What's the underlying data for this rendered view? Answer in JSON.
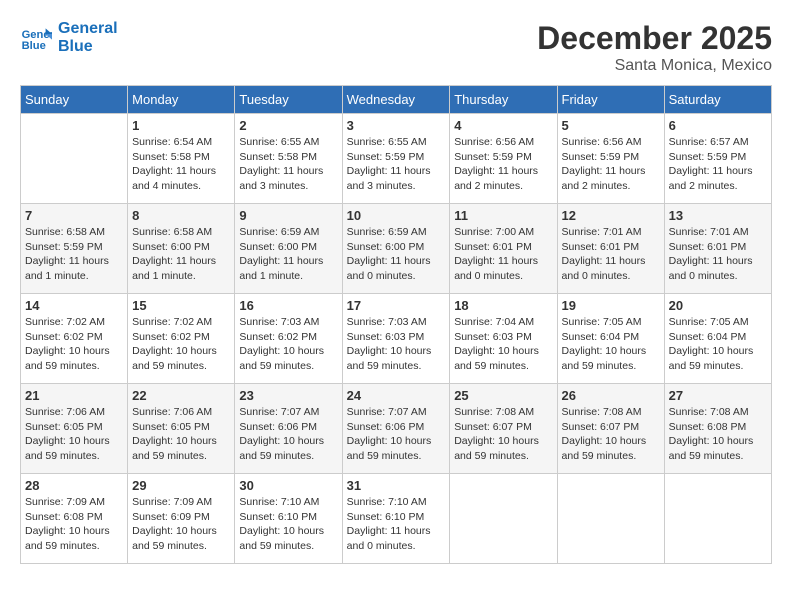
{
  "header": {
    "logo_line1": "General",
    "logo_line2": "Blue",
    "month": "December 2025",
    "location": "Santa Monica, Mexico"
  },
  "weekdays": [
    "Sunday",
    "Monday",
    "Tuesday",
    "Wednesday",
    "Thursday",
    "Friday",
    "Saturday"
  ],
  "weeks": [
    [
      {
        "day": "",
        "info": ""
      },
      {
        "day": "1",
        "info": "Sunrise: 6:54 AM\nSunset: 5:58 PM\nDaylight: 11 hours\nand 4 minutes."
      },
      {
        "day": "2",
        "info": "Sunrise: 6:55 AM\nSunset: 5:58 PM\nDaylight: 11 hours\nand 3 minutes."
      },
      {
        "day": "3",
        "info": "Sunrise: 6:55 AM\nSunset: 5:59 PM\nDaylight: 11 hours\nand 3 minutes."
      },
      {
        "day": "4",
        "info": "Sunrise: 6:56 AM\nSunset: 5:59 PM\nDaylight: 11 hours\nand 2 minutes."
      },
      {
        "day": "5",
        "info": "Sunrise: 6:56 AM\nSunset: 5:59 PM\nDaylight: 11 hours\nand 2 minutes."
      },
      {
        "day": "6",
        "info": "Sunrise: 6:57 AM\nSunset: 5:59 PM\nDaylight: 11 hours\nand 2 minutes."
      }
    ],
    [
      {
        "day": "7",
        "info": "Sunrise: 6:58 AM\nSunset: 5:59 PM\nDaylight: 11 hours\nand 1 minute."
      },
      {
        "day": "8",
        "info": "Sunrise: 6:58 AM\nSunset: 6:00 PM\nDaylight: 11 hours\nand 1 minute."
      },
      {
        "day": "9",
        "info": "Sunrise: 6:59 AM\nSunset: 6:00 PM\nDaylight: 11 hours\nand 1 minute."
      },
      {
        "day": "10",
        "info": "Sunrise: 6:59 AM\nSunset: 6:00 PM\nDaylight: 11 hours\nand 0 minutes."
      },
      {
        "day": "11",
        "info": "Sunrise: 7:00 AM\nSunset: 6:01 PM\nDaylight: 11 hours\nand 0 minutes."
      },
      {
        "day": "12",
        "info": "Sunrise: 7:01 AM\nSunset: 6:01 PM\nDaylight: 11 hours\nand 0 minutes."
      },
      {
        "day": "13",
        "info": "Sunrise: 7:01 AM\nSunset: 6:01 PM\nDaylight: 11 hours\nand 0 minutes."
      }
    ],
    [
      {
        "day": "14",
        "info": "Sunrise: 7:02 AM\nSunset: 6:02 PM\nDaylight: 10 hours\nand 59 minutes."
      },
      {
        "day": "15",
        "info": "Sunrise: 7:02 AM\nSunset: 6:02 PM\nDaylight: 10 hours\nand 59 minutes."
      },
      {
        "day": "16",
        "info": "Sunrise: 7:03 AM\nSunset: 6:02 PM\nDaylight: 10 hours\nand 59 minutes."
      },
      {
        "day": "17",
        "info": "Sunrise: 7:03 AM\nSunset: 6:03 PM\nDaylight: 10 hours\nand 59 minutes."
      },
      {
        "day": "18",
        "info": "Sunrise: 7:04 AM\nSunset: 6:03 PM\nDaylight: 10 hours\nand 59 minutes."
      },
      {
        "day": "19",
        "info": "Sunrise: 7:05 AM\nSunset: 6:04 PM\nDaylight: 10 hours\nand 59 minutes."
      },
      {
        "day": "20",
        "info": "Sunrise: 7:05 AM\nSunset: 6:04 PM\nDaylight: 10 hours\nand 59 minutes."
      }
    ],
    [
      {
        "day": "21",
        "info": "Sunrise: 7:06 AM\nSunset: 6:05 PM\nDaylight: 10 hours\nand 59 minutes."
      },
      {
        "day": "22",
        "info": "Sunrise: 7:06 AM\nSunset: 6:05 PM\nDaylight: 10 hours\nand 59 minutes."
      },
      {
        "day": "23",
        "info": "Sunrise: 7:07 AM\nSunset: 6:06 PM\nDaylight: 10 hours\nand 59 minutes."
      },
      {
        "day": "24",
        "info": "Sunrise: 7:07 AM\nSunset: 6:06 PM\nDaylight: 10 hours\nand 59 minutes."
      },
      {
        "day": "25",
        "info": "Sunrise: 7:08 AM\nSunset: 6:07 PM\nDaylight: 10 hours\nand 59 minutes."
      },
      {
        "day": "26",
        "info": "Sunrise: 7:08 AM\nSunset: 6:07 PM\nDaylight: 10 hours\nand 59 minutes."
      },
      {
        "day": "27",
        "info": "Sunrise: 7:08 AM\nSunset: 6:08 PM\nDaylight: 10 hours\nand 59 minutes."
      }
    ],
    [
      {
        "day": "28",
        "info": "Sunrise: 7:09 AM\nSunset: 6:08 PM\nDaylight: 10 hours\nand 59 minutes."
      },
      {
        "day": "29",
        "info": "Sunrise: 7:09 AM\nSunset: 6:09 PM\nDaylight: 10 hours\nand 59 minutes."
      },
      {
        "day": "30",
        "info": "Sunrise: 7:10 AM\nSunset: 6:10 PM\nDaylight: 10 hours\nand 59 minutes."
      },
      {
        "day": "31",
        "info": "Sunrise: 7:10 AM\nSunset: 6:10 PM\nDaylight: 11 hours\nand 0 minutes."
      },
      {
        "day": "",
        "info": ""
      },
      {
        "day": "",
        "info": ""
      },
      {
        "day": "",
        "info": ""
      }
    ]
  ]
}
